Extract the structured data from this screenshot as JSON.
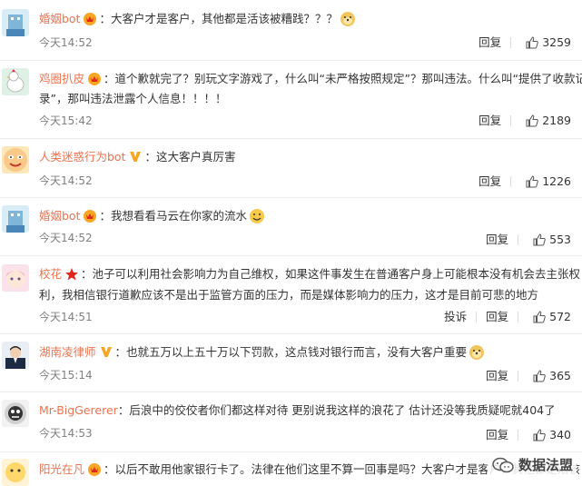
{
  "comments": [
    {
      "username": "婚姻bot",
      "badge": "crown-icon",
      "text": "大客户才是客户，其他都是活该被糟践？？？",
      "emoji": "doge-emoji",
      "time": "今天14:52",
      "reply_label": "回复",
      "likes": "3259"
    },
    {
      "username": "鸡圈扒皮",
      "badge": "crown-icon",
      "text_line1": "道个歉就完了？别玩文字游戏了，什么叫“未严格按照规定”？那叫违法。什么叫“提供了收款记",
      "text_line2": "录”，那叫违法泄露个人信息！！！！",
      "time": "今天15:42",
      "reply_label": "回复",
      "likes": "2189"
    },
    {
      "username": "人类迷惑行为bot",
      "badge": "verified-v-icon",
      "text": "这大客户真厉害",
      "time": "今天14:52",
      "reply_label": "回复",
      "likes": "1226"
    },
    {
      "username": "婚姻bot",
      "badge": "crown-icon",
      "text": "我想看看马云在你家的流水",
      "emoji": "smile-emoji",
      "time": "今天14:52",
      "reply_label": "回复",
      "likes": "553"
    },
    {
      "username": "校花",
      "badge": "red-star-icon",
      "text_line1": "池子可以利用社会影响力为自己维权，如果这件事发生在普通客户身上可能根本没有机会去主张权",
      "text_line2": "利，我相信银行道歉应该不是出于监管方面的压力，而是媒体影响力的压力，这才是目前可悲的地方",
      "time": "今天14:51",
      "report_label": "投诉",
      "reply_label": "回复",
      "likes": "572"
    },
    {
      "username": "湖南凌律师",
      "badge": "verified-v-icon",
      "text": "也就五万以上五十万以下罚款，这点钱对银行而言，没有大客户重要",
      "emoji": "doge-emoji",
      "time": "今天15:14",
      "reply_label": "回复",
      "likes": "365"
    },
    {
      "username": "Mr-BigGererer",
      "text": "后浪中的佼佼者你们都这样对待 更别说我这样的浪花了 估计还没等我质疑呢就404了",
      "time": "今天14:53",
      "reply_label": "回复",
      "likes": "340"
    },
    {
      "username": "阳光在凡",
      "badge": "crown-icon",
      "text": "以后不敢用他家银行卡了。法律在他们这里不算一回事是吗？大客户才是客户，其他都是活该"
    }
  ],
  "watermark": "数据法盟",
  "colors": {
    "username": "#eb7350",
    "time": "#808080",
    "badge_vip": "#f7a623",
    "badge_v": "#f5a623"
  }
}
